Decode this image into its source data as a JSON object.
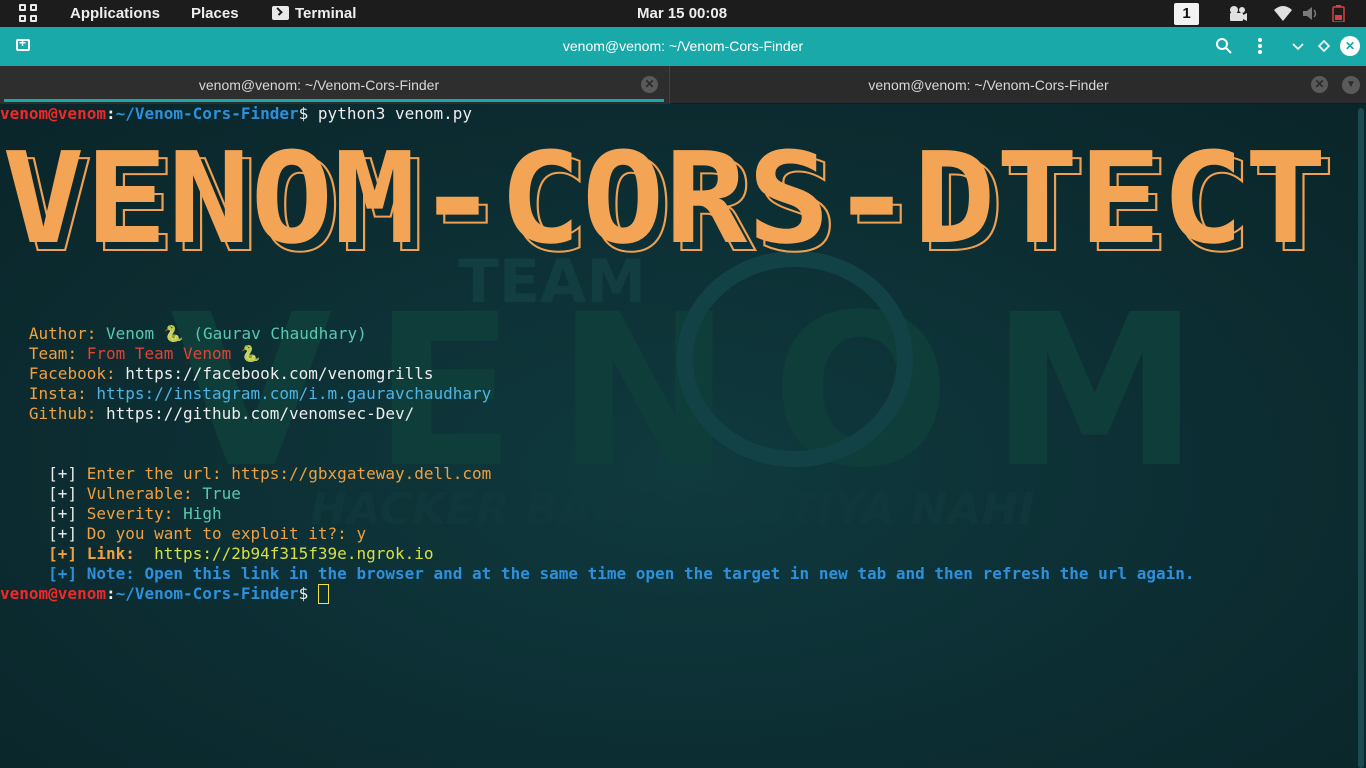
{
  "topbar": {
    "applications": "Applications",
    "places": "Places",
    "terminal": "Terminal",
    "clock": "Mar 15  00:08",
    "workspace": "1",
    "icons": [
      "apps-grid-icon",
      "terminal-icon",
      "camera-icon",
      "wifi-icon",
      "volume-icon",
      "battery-icon"
    ]
  },
  "window": {
    "title": "venom@venom: ~/Venom-Cors-Finder",
    "accent": "#1aa9a9"
  },
  "tabs": [
    {
      "label": "venom@venom: ~/Venom-Cors-Finder",
      "active": true
    },
    {
      "label": "venom@venom: ~/Venom-Cors-Finder",
      "active": false
    }
  ],
  "terminal": {
    "prompt_user": "venom@venom",
    "prompt_path": "~/Venom-Cors-Finder",
    "prompt_sign": "$",
    "command": "python3 venom.py",
    "banner": "VENOM-CORS-DTECT",
    "author_label": "Author:",
    "author_value": "Venom 🐍 (Gaurav Chaudhary)",
    "team_label": "Team:",
    "team_value": "From Team Venom 🐍",
    "facebook_label": "Facebook:",
    "facebook_value": "https://facebook.com/venomgrills",
    "insta_label": "Insta:",
    "insta_value": "https://instagram.com/i.m.gauravchaudhary",
    "github_label": "Github:",
    "github_value": "https://github.com/venomsec-Dev/",
    "marker": "[+]",
    "url_label": "Enter the url:",
    "url_value": "https://gbxgateway.dell.com",
    "vuln_label": "Vulnerable:",
    "vuln_value": "True",
    "sev_label": "Severity:",
    "sev_value": "High",
    "exploit_label": "Do you want to exploit it?:",
    "exploit_value": "y",
    "link_label": "Link:",
    "link_value": "https://2b94f315f39e.ngrok.io",
    "note": "Note: Open this link in the browser and at the same time open the target in new tab and then refresh the url again."
  },
  "wallpaper": {
    "team": "TEAM",
    "letters": "VENOM",
    "tagline": "HACKER BANQ CHUTIYA NAHI"
  }
}
